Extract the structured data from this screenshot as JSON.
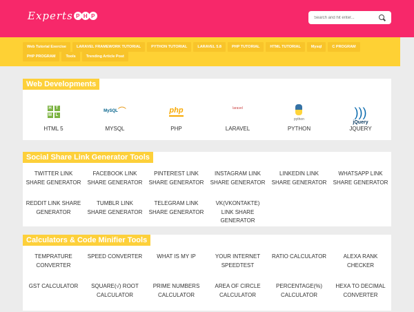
{
  "header": {
    "logo_text": "Experts",
    "logo_badge": [
      "P",
      "H",
      "P"
    ],
    "search_placeholder": "Search and hit enter..."
  },
  "nav": [
    "Web Tutorial Exercise",
    "LARAVEL FRAMEWORK TUTORIAL",
    "PYTHON TUTORIAL",
    "LARAVEL 5.8",
    "PHP TUTORIAL",
    "HTML TUTORIAL",
    "Mysql",
    "C PROGRAM",
    "PHP PROGRAM",
    "Tools",
    "Trending Article Post"
  ],
  "web_dev": {
    "title": "Web Developments",
    "items": [
      {
        "label": "HTML 5",
        "icon": "html5-icon",
        "icon_text": [
          "H",
          "T",
          "M",
          "L"
        ]
      },
      {
        "label": "MYSQL",
        "icon": "mysql-icon",
        "icon_text": "MySQL"
      },
      {
        "label": "PHP",
        "icon": "php-icon",
        "icon_text": "php"
      },
      {
        "label": "LARAVEL",
        "icon": "laravel-icon",
        "icon_text": "laravel"
      },
      {
        "label": "PYTHON",
        "icon": "python-icon",
        "icon_text": "python"
      },
      {
        "label": "JQUERY",
        "icon": "jquery-icon",
        "icon_text": "jQuery"
      }
    ]
  },
  "social": {
    "title": "Social Share Link Generator Tools",
    "items": [
      "TWITTER LINK SHARE GENERATOR",
      "FACEBOOK LINK SHARE GENERATOR",
      "PINTEREST LINK SHARE GENERATOR",
      "INSTAGRAM LINK SHARE GENERATOR",
      "LINKEDIN LINK SHARE GENERATOR",
      "WHATSAPP LINK SHARE GENERATOR",
      "REDDIT LINK SHARE GENERATOR",
      "TUMBLR LINK SHARE GENERATOR",
      "TELEGRAM LINK SHARE GENERATOR",
      "VK(VKONTAKTE) LINK SHARE GENERATOR"
    ]
  },
  "calc": {
    "title": "Calculators & Code Minifier Tools",
    "items": [
      "TEMPRATURE CONVERTER",
      "SPEED CONVERTER",
      "WHAT IS MY IP",
      "YOUR INTERNET SPEEDTEST",
      "RATIO CALCULATOR",
      "ALEXA RANK CHECKER",
      "GST CALCULATOR",
      "SQUARE(√) ROOT CALCULATOR",
      "PRIME NUMBERS CALCULATOR",
      "AREA OF CIRCLE CALCULATOR",
      "PERCENTAGE(%) CALCULATOR",
      "HEXA TO DECIMAL CONVERTER"
    ]
  },
  "colors": {
    "header": "#f7286a",
    "nav": "#fed134",
    "accent": "#fdd03a"
  }
}
